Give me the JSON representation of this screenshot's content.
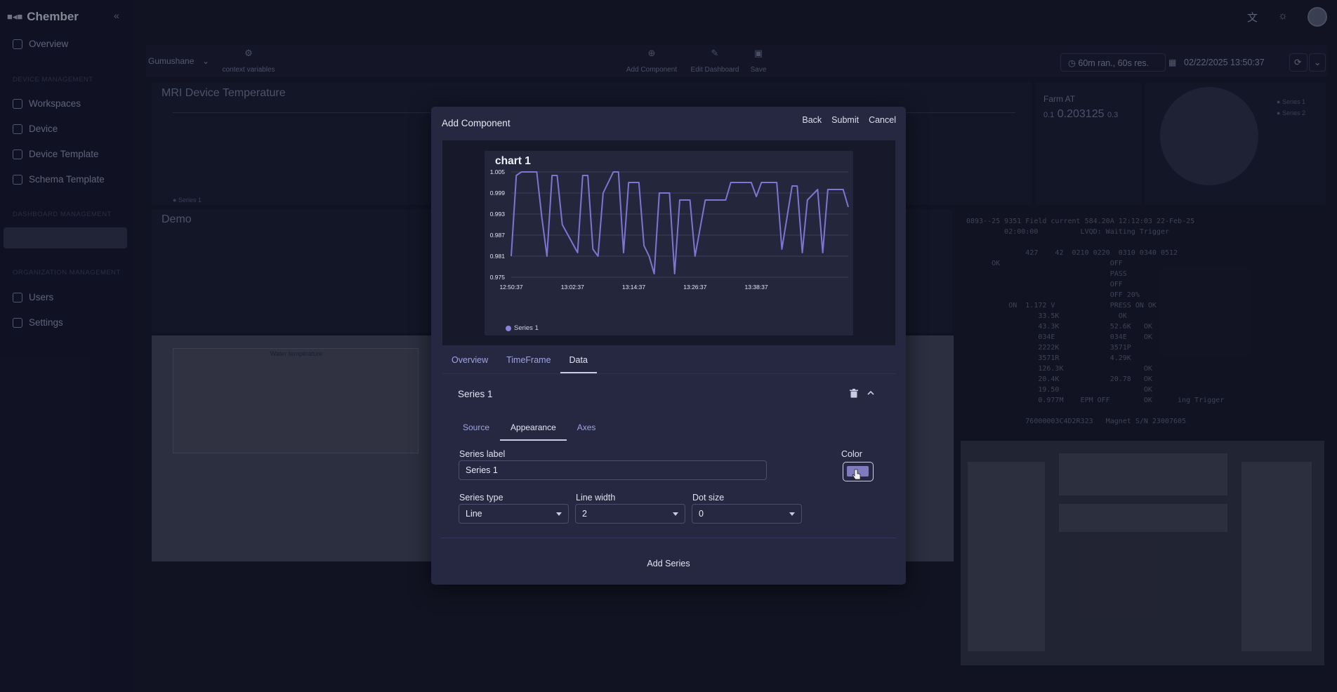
{
  "app": {
    "name": "Chember",
    "nav": [
      {
        "label": "Overview"
      },
      {
        "label": "Workspaces"
      },
      {
        "label": "Device"
      },
      {
        "label": "Device Template"
      },
      {
        "label": "Schema Template"
      },
      {
        "label": "Users"
      },
      {
        "label": "Settings"
      }
    ],
    "sections": [
      "DEVICE MANAGEMENT",
      "DASHBOARD MANAGEMENT",
      "ORGANIZATION MANAGEMENT"
    ]
  },
  "toolbar": {
    "workspace": "Gumushane",
    "context_variables": "context variables",
    "add_component": "Add Component",
    "edit_dashboard": "Edit Dashboard",
    "save": "Save",
    "range": "60m ran., 60s res.",
    "datetime": "02/22/2025 13:50:37"
  },
  "background_panels": {
    "mri_title": "MRI Device Temperature",
    "demo_title": "Demo",
    "farm_title": "Farm AT",
    "farm_value": "0.203125",
    "farm_min": "0.1",
    "farm_max": "0.3",
    "water_title": "Water temperature",
    "series_legend_1": "Series 1",
    "series_legend_2": "Series 2",
    "terminal_text": "0893--25 9351 Field current 584.20A 12:12:03 22-Feb-25\n         02:00:00          LVQD: Waiting Trigger\n\n              427    42  0210 0220  0310 0340 0512\n      OK                          OFF\n                                  PASS\n                                  OFF\n                                  OFF 20%\n          ON  1.172 V             PRESS ON OK\n                 33.5K              OK\n                 43.3K            52.6K   OK\n                 034E             034E    OK\n                 2222K            3571P\n                 3571R            4.29K\n                 126.3K                   OK\n                 20.4K            20.78   OK\n                 19.50                    OK\n                 0.977M    EPM OFF        OK      ing Trigger\n\n              76000003C4D2R323   Magnet S/N 23007605"
  },
  "modal": {
    "title": "Add Component",
    "back": "Back",
    "submit": "Submit",
    "cancel": "Cancel",
    "tabs": [
      "Overview",
      "TimeFrame",
      "Data"
    ],
    "active_tab": "Data",
    "series_title": "Series 1",
    "sub_tabs": [
      "Source",
      "Appearance",
      "Axes"
    ],
    "active_sub_tab": "Appearance",
    "series_label_label": "Series label",
    "series_label_value": "Series 1",
    "color_label": "Color",
    "color_value": "#807bbf",
    "series_type_label": "Series type",
    "series_type_value": "Line",
    "line_width_label": "Line width",
    "line_width_value": "2",
    "dot_size_label": "Dot size",
    "dot_size_value": "0",
    "add_series": "Add Series"
  },
  "chart_data": {
    "type": "line",
    "title": "chart 1",
    "xlabel": "",
    "ylabel": "",
    "x_ticks": [
      "12:50:37",
      "13:02:37",
      "13:14:37",
      "13:26:37",
      "13:38:37"
    ],
    "y_ticks": [
      "1.005",
      "0.999",
      "0.993",
      "0.987",
      "0.981",
      "0.975"
    ],
    "ylim": [
      0.975,
      1.005
    ],
    "grid": true,
    "legend_position": "bottom-left",
    "series": [
      {
        "name": "Series 1",
        "color": "#7b76d4",
        "x_minutes": [
          0,
          1,
          2,
          5,
          6,
          7,
          8,
          9,
          10,
          13,
          14,
          15,
          16,
          17,
          18,
          20,
          21,
          22,
          23,
          25,
          26,
          27,
          28,
          29,
          31,
          32,
          33,
          34,
          35,
          36,
          38,
          39,
          40,
          42,
          43,
          44,
          45,
          47,
          48,
          49,
          51,
          52,
          53,
          55,
          56,
          57,
          58,
          60,
          61,
          62,
          63,
          65,
          66
        ],
        "values": [
          0.981,
          1.004,
          1.005,
          1.005,
          0.992,
          0.981,
          1.004,
          1.004,
          0.99,
          0.982,
          1.004,
          1.004,
          0.983,
          0.981,
          0.999,
          1.005,
          1.005,
          0.982,
          1.002,
          1.002,
          0.984,
          0.981,
          0.976,
          0.999,
          0.999,
          0.976,
          0.997,
          0.997,
          0.997,
          0.981,
          0.997,
          0.997,
          0.997,
          0.997,
          1.002,
          1.002,
          1.002,
          1.002,
          0.998,
          1.002,
          1.002,
          1.002,
          0.983,
          1.001,
          1.001,
          0.982,
          0.997,
          1.0,
          0.982,
          1.0,
          1.0,
          1.0,
          0.995
        ]
      }
    ]
  }
}
